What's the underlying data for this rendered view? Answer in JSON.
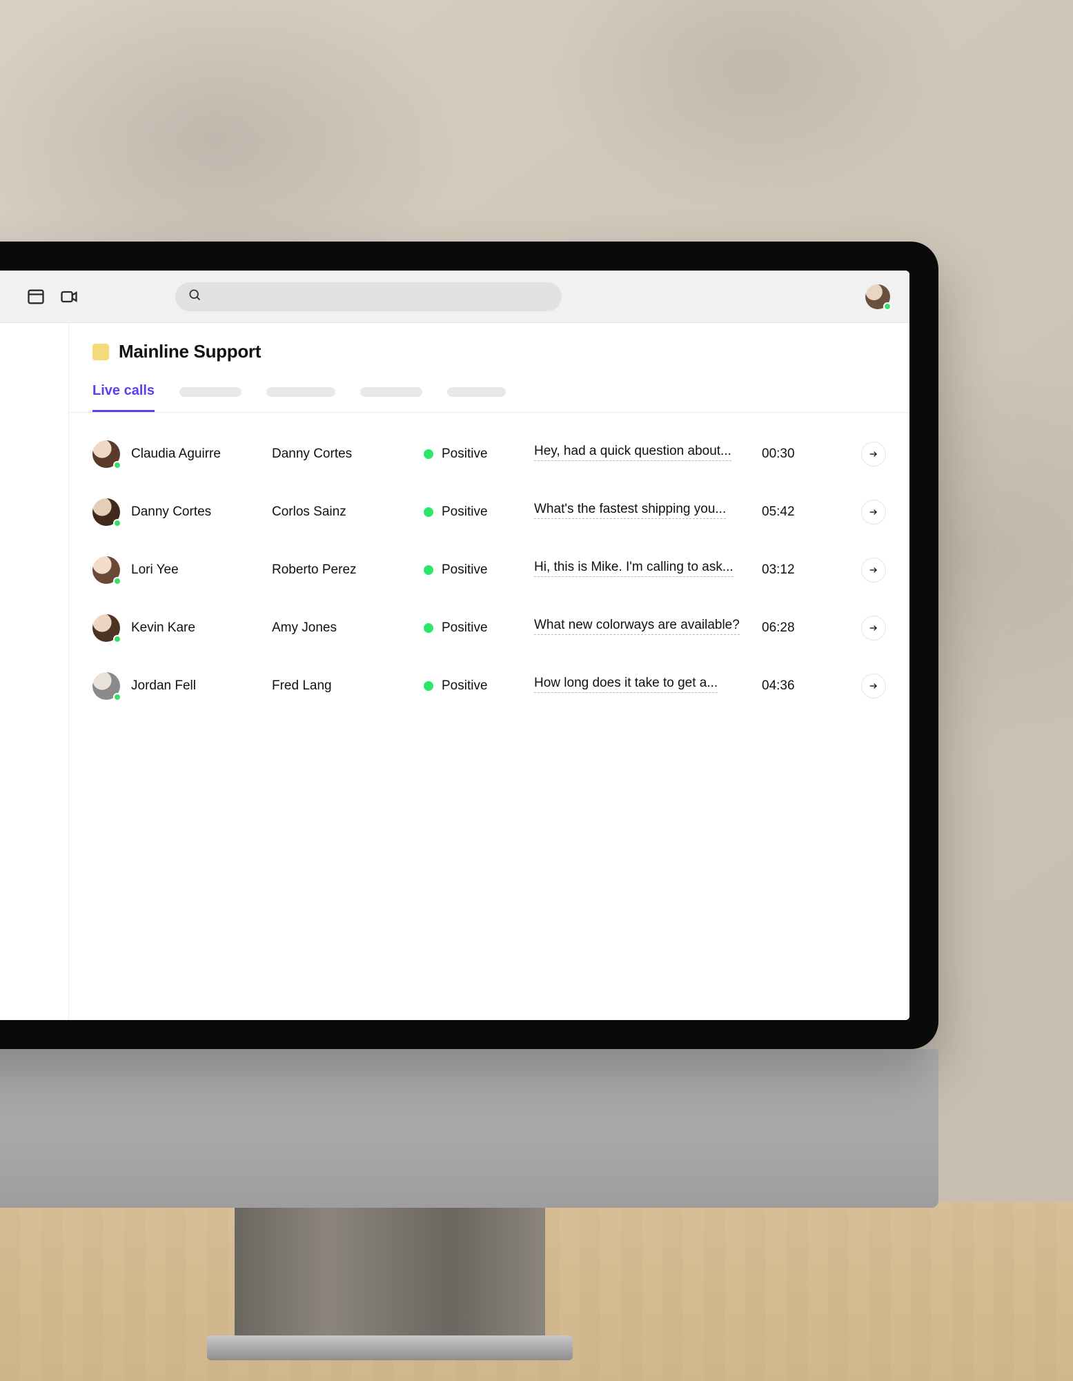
{
  "header": {
    "search_placeholder": ""
  },
  "page": {
    "title": "Mainline Support"
  },
  "tabs": {
    "active_label": "Live calls"
  },
  "calls": [
    {
      "caller": "Claudia Aguirre",
      "agent": "Danny Cortes",
      "sentiment": "Positive",
      "snippet": "Hey, had a quick question about...",
      "duration": "00:30"
    },
    {
      "caller": "Danny Cortes",
      "agent": "Corlos Sainz",
      "sentiment": "Positive",
      "snippet": "What's the fastest shipping you...",
      "duration": "05:42"
    },
    {
      "caller": "Lori Yee",
      "agent": "Roberto Perez",
      "sentiment": "Positive",
      "snippet": "Hi, this is Mike. I'm calling to ask...",
      "duration": "03:12"
    },
    {
      "caller": "Kevin Kare",
      "agent": "Amy Jones",
      "sentiment": "Positive",
      "snippet": "What new colorways are available?",
      "duration": "06:28"
    },
    {
      "caller": "Jordan Fell",
      "agent": "Fred Lang",
      "sentiment": "Positive",
      "snippet": "How long does it take to get a...",
      "duration": "04:36"
    }
  ]
}
